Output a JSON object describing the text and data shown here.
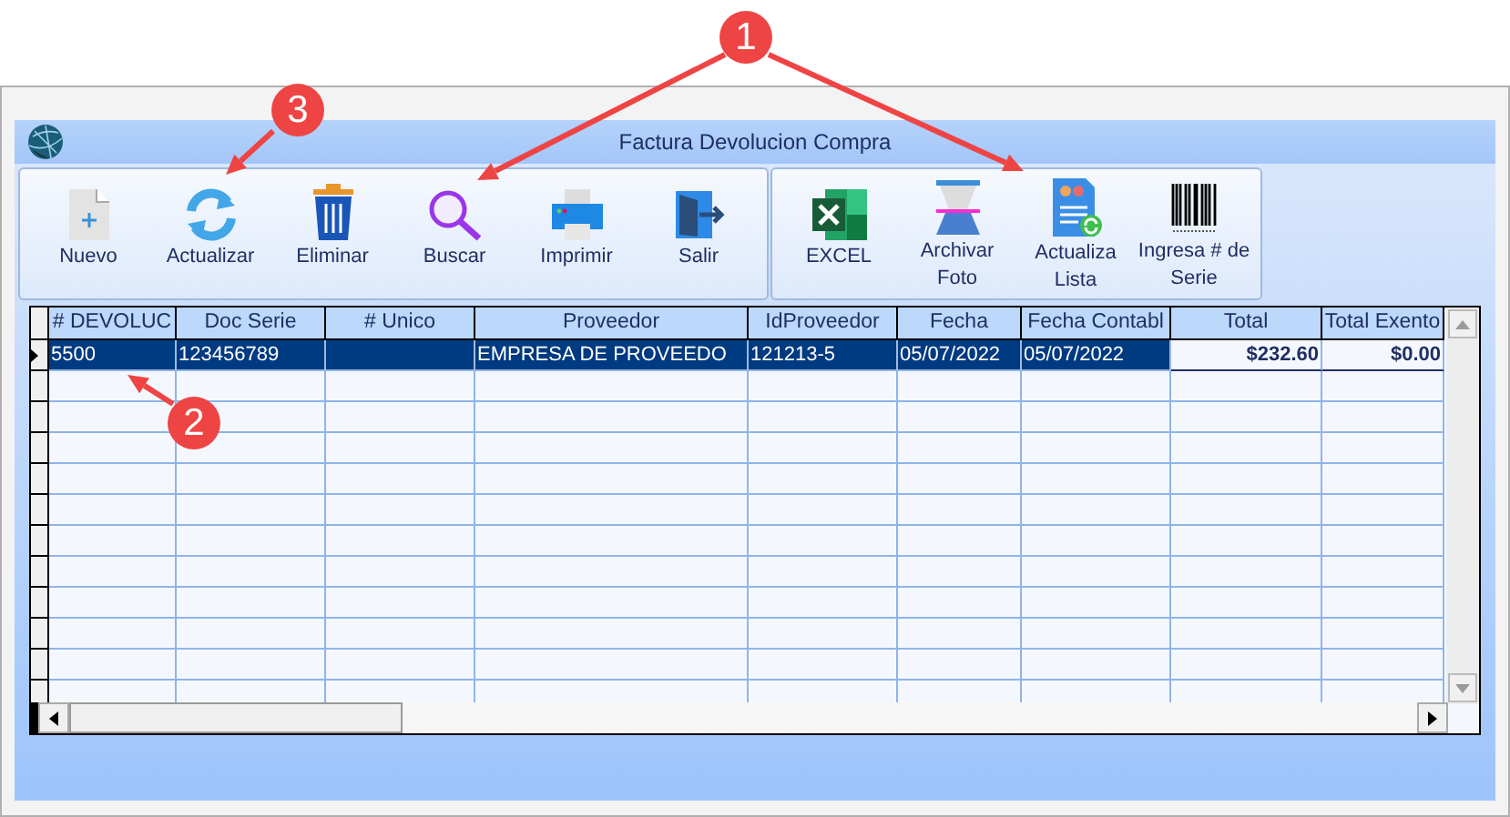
{
  "window": {
    "title": "Factura Devolucion Compra"
  },
  "toolbar_groups": [
    {
      "buttons": [
        {
          "label": "Nuevo",
          "kind": "new"
        },
        {
          "label": "Actualizar",
          "kind": "refresh"
        },
        {
          "label": "Eliminar",
          "kind": "delete"
        },
        {
          "label": "Buscar",
          "kind": "search"
        },
        {
          "label": "Imprimir",
          "kind": "print"
        },
        {
          "label": "Salir",
          "kind": "exit"
        }
      ]
    },
    {
      "buttons": [
        {
          "label": "EXCEL",
          "kind": "excel"
        },
        {
          "label": "Archivar Foto",
          "kind": "scanner"
        },
        {
          "label": "Actualiza Lista",
          "kind": "list"
        },
        {
          "label": "Ingresa # de Serie",
          "kind": "barcode"
        }
      ]
    }
  ],
  "table": {
    "columns": [
      "# DEVOLUC",
      "Doc Serie",
      "# Unico",
      "Proveedor",
      "IdProveedor",
      "Fecha",
      "Fecha Contabl",
      "Total",
      "Total Exento"
    ],
    "rows": [
      {
        "selected": true,
        "cells": [
          "5500",
          "123456789",
          "",
          "EMPRESA DE PROVEEDO",
          "121213-5",
          "05/07/2022",
          "05/07/2022",
          "$232.60",
          "$0.00"
        ]
      }
    ]
  },
  "callouts": [
    {
      "label": "1"
    },
    {
      "label": "2"
    },
    {
      "label": "3"
    }
  ]
}
